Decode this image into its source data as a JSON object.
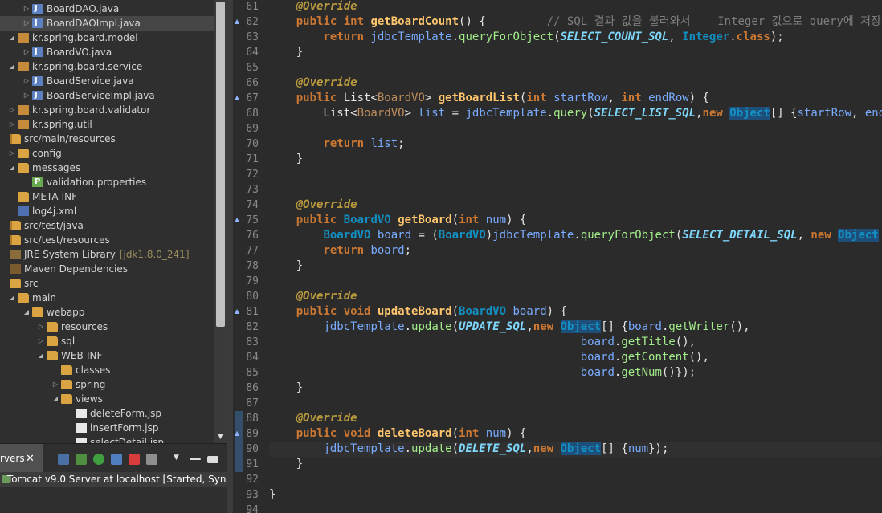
{
  "explorer": {
    "items": [
      {
        "label": "BoardDAO.java",
        "indent": 28,
        "arrow": "▷",
        "icon": "java"
      },
      {
        "label": "BoardDAOImpl.java",
        "indent": 28,
        "arrow": "▷",
        "icon": "java"
      },
      {
        "label": "kr.spring.board.model",
        "indent": 10,
        "arrow": "◢",
        "icon": "pkg"
      },
      {
        "label": "BoardVO.java",
        "indent": 28,
        "arrow": "▷",
        "icon": "java"
      },
      {
        "label": "kr.spring.board.service",
        "indent": 10,
        "arrow": "◢",
        "icon": "pkg"
      },
      {
        "label": "BoardService.java",
        "indent": 28,
        "arrow": "▷",
        "icon": "java"
      },
      {
        "label": "BoardServiceImpl.java",
        "indent": 28,
        "arrow": "▷",
        "icon": "java"
      },
      {
        "label": "kr.spring.board.validator",
        "indent": 10,
        "arrow": "▷",
        "icon": "pkg"
      },
      {
        "label": "kr.spring.util",
        "indent": 10,
        "arrow": "▷",
        "icon": "pkg"
      },
      {
        "label": "src/main/resources",
        "indent": 0,
        "arrow": "",
        "icon": "srcfolder"
      },
      {
        "label": "config",
        "indent": 10,
        "arrow": "▷",
        "icon": "folder"
      },
      {
        "label": "messages",
        "indent": 10,
        "arrow": "◢",
        "icon": "folder"
      },
      {
        "label": "validation.properties",
        "indent": 28,
        "arrow": "",
        "icon": "props"
      },
      {
        "label": "META-INF",
        "indent": 10,
        "arrow": "",
        "icon": "folder"
      },
      {
        "label": "log4j.xml",
        "indent": 10,
        "arrow": "",
        "icon": "xml"
      },
      {
        "label": "src/test/java",
        "indent": 0,
        "arrow": "",
        "icon": "srcfolder"
      },
      {
        "label": "src/test/resources",
        "indent": 0,
        "arrow": "",
        "icon": "srcfolder"
      },
      {
        "label": "JRE System Library",
        "extra": "[jdk1.8.0_241]",
        "indent": 0,
        "arrow": "",
        "icon": "lib"
      },
      {
        "label": "Maven Dependencies",
        "indent": 0,
        "arrow": "",
        "icon": "maven"
      },
      {
        "label": "src",
        "indent": 0,
        "arrow": "",
        "icon": "folder"
      },
      {
        "label": "main",
        "indent": 10,
        "arrow": "◢",
        "icon": "folder"
      },
      {
        "label": "webapp",
        "indent": 28,
        "arrow": "◢",
        "icon": "folder"
      },
      {
        "label": "resources",
        "indent": 46,
        "arrow": "▷",
        "icon": "folder"
      },
      {
        "label": "sql",
        "indent": 46,
        "arrow": "▷",
        "icon": "folder"
      },
      {
        "label": "WEB-INF",
        "indent": 46,
        "arrow": "◢",
        "icon": "folder"
      },
      {
        "label": "classes",
        "indent": 64,
        "arrow": "",
        "icon": "folder"
      },
      {
        "label": "spring",
        "indent": 64,
        "arrow": "▷",
        "icon": "folder"
      },
      {
        "label": "views",
        "indent": 64,
        "arrow": "◢",
        "icon": "folder"
      },
      {
        "label": "deleteForm.jsp",
        "indent": 82,
        "arrow": "",
        "icon": "file"
      },
      {
        "label": "insertForm.jsp",
        "indent": 82,
        "arrow": "",
        "icon": "file"
      },
      {
        "label": "selectDetail.jsp",
        "indent": 82,
        "arrow": "",
        "icon": "file"
      }
    ],
    "selected_index": 1
  },
  "servers": {
    "tab_label": "rvers",
    "close_glyph": "✕",
    "row_label": "Tomcat v9.0 Server at localhost",
    "row_status": "[Started, Synchronized]"
  },
  "editor": {
    "lines": [
      {
        "n": "61",
        "marker": "",
        "html": "    <span class='t-ann'>@Override</span>"
      },
      {
        "n": "62",
        "marker": "▲",
        "html": "    <span class='t-kw'>public int</span> <span class='t-fn'>getBoardCount</span>() {         <span class='t-cm'>// SQL 결과 값을 불러와서    Integer 값으로 query에 저장</span>"
      },
      {
        "n": "63",
        "marker": "",
        "html": "        <span class='t-kw'>return</span> <span class='t-var'>jdbcTemplate</span>.<span class='t-call'>queryForObject</span>(<span class='t-const'>SELECT_COUNT_SQL</span>, <span class='t-type'>Integer</span>.<span class='t-kw'>class</span>);"
      },
      {
        "n": "64",
        "marker": "",
        "html": "    }"
      },
      {
        "n": "65",
        "marker": "",
        "html": ""
      },
      {
        "n": "66",
        "marker": "",
        "html": "    <span class='t-ann'>@Override</span>"
      },
      {
        "n": "67",
        "marker": "▲",
        "html": "    <span class='t-kw'>public</span> List&lt;<span class='t-gen'>BoardVO</span>&gt; <span class='t-fn'>getBoardList</span>(<span class='t-kw'>int</span> <span class='t-var'>startRow</span>, <span class='t-kw'>int</span> <span class='t-var'>endRow</span>) {"
      },
      {
        "n": "68",
        "marker": "",
        "html": "        List&lt;<span class='t-gen'>BoardVO</span>&gt; <span class='t-var'>list</span> = <span class='t-var'>jdbcTemplate</span>.<span class='t-call'>query</span>(<span class='t-const'>SELECT_LIST_SQL</span>,<span class='t-kw'>new</span> <span class='t-hl'>Object</span>[] {<span class='t-var'>startRow</span>, <span class='t-var'>endRow</span>}"
      },
      {
        "n": "69",
        "marker": "",
        "html": ""
      },
      {
        "n": "70",
        "marker": "",
        "html": "        <span class='t-kw'>return</span> <span class='t-var'>list</span>;"
      },
      {
        "n": "71",
        "marker": "",
        "html": "    }"
      },
      {
        "n": "72",
        "marker": "",
        "html": ""
      },
      {
        "n": "73",
        "marker": "",
        "html": ""
      },
      {
        "n": "74",
        "marker": "",
        "html": "    <span class='t-ann'>@Override</span>"
      },
      {
        "n": "75",
        "marker": "▲",
        "html": "    <span class='t-kw'>public</span> <span class='t-type'>BoardVO</span> <span class='t-fn'>getBoard</span>(<span class='t-kw'>int</span> <span class='t-var'>num</span>) {"
      },
      {
        "n": "76",
        "marker": "",
        "html": "        <span class='t-type'>BoardVO</span> <span class='t-var'>board</span> = (<span class='t-type'>BoardVO</span>)<span class='t-var'>jdbcTemplate</span>.<span class='t-call'>queryForObject</span>(<span class='t-const'>SELECT_DETAIL_SQL</span>, <span class='t-kw'>new</span> <span class='t-hl'>Object</span>"
      },
      {
        "n": "77",
        "marker": "",
        "html": "        <span class='t-kw'>return</span> <span class='t-var'>board</span>;"
      },
      {
        "n": "78",
        "marker": "",
        "html": "    }"
      },
      {
        "n": "79",
        "marker": "",
        "html": ""
      },
      {
        "n": "80",
        "marker": "",
        "html": "    <span class='t-ann'>@Override</span>"
      },
      {
        "n": "81",
        "marker": "▲",
        "html": "    <span class='t-kw'>public void</span> <span class='t-fn'>updateBoard</span>(<span class='t-type'>BoardVO</span> <span class='t-var'>board</span>) {"
      },
      {
        "n": "82",
        "marker": "",
        "html": "        <span class='t-var'>jdbcTemplate</span>.<span class='t-call'>update</span>(<span class='t-const'>UPDATE_SQL</span>,<span class='t-kw'>new</span> <span class='t-hl'>Object</span>[] {<span class='t-var'>board</span>.<span class='t-call'>getWriter</span>(),"
      },
      {
        "n": "83",
        "marker": "",
        "html": "                                              <span class='t-var'>board</span>.<span class='t-call'>getTitle</span>(),"
      },
      {
        "n": "84",
        "marker": "",
        "html": "                                              <span class='t-var'>board</span>.<span class='t-call'>getContent</span>(),"
      },
      {
        "n": "85",
        "marker": "",
        "html": "                                              <span class='t-var'>board</span>.<span class='t-call'>getNum</span>()});"
      },
      {
        "n": "86",
        "marker": "",
        "html": "    }"
      },
      {
        "n": "87",
        "marker": "",
        "html": ""
      },
      {
        "n": "88",
        "marker": "",
        "html": "    <span class='t-ann'>@Override</span>"
      },
      {
        "n": "89",
        "marker": "▲",
        "html": "    <span class='t-kw'>public void</span> <span class='t-fn'>deleteBoard</span>(<span class='t-kw'>int</span> <span class='t-var'>num</span>) {"
      },
      {
        "n": "90",
        "marker": "",
        "html": "        <span class='t-var'>jdbcTemplate</span>.<span class='t-call'>update</span>(<span class='t-const'>DELETE_SQL</span>,<span class='t-kw'>new</span> <span class='t-hl'>Object</span>[] {<span class='t-var'>num</span>});"
      },
      {
        "n": "91",
        "marker": "",
        "html": "    }"
      },
      {
        "n": "92",
        "marker": "",
        "html": ""
      },
      {
        "n": "93",
        "marker": "",
        "html": "}"
      },
      {
        "n": "94",
        "marker": "",
        "html": ""
      }
    ],
    "current_line": "90"
  },
  "colors": {
    "editor_bg": "#2b2b2b",
    "annotation": "#ba9a3d",
    "keyword": "#cc7832",
    "method": "#ffc66d",
    "constant": "#7fd7fb",
    "type": "#1290c3"
  }
}
